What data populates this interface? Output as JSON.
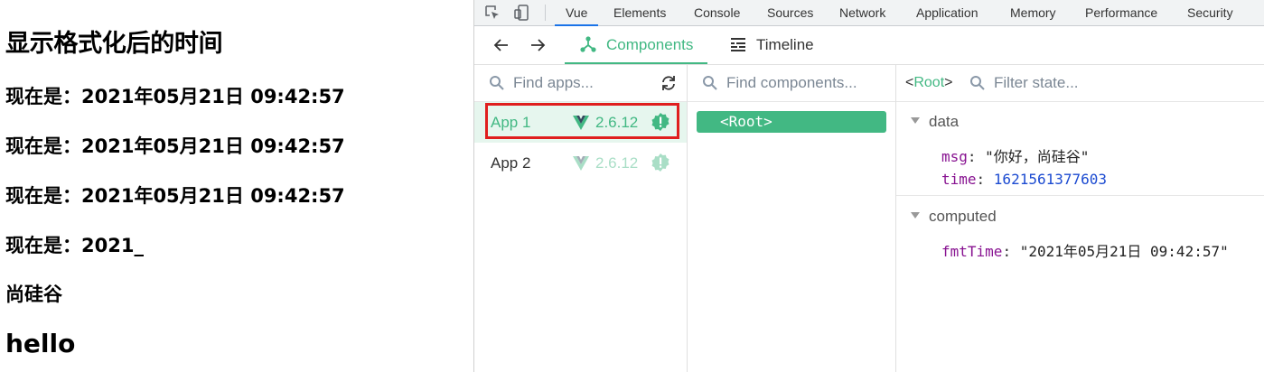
{
  "page": {
    "title": "显示格式化后的时间",
    "lines": [
      "现在是：2021年05月21日 09:42:57",
      "现在是：2021年05月21日 09:42:57",
      "现在是：2021年05月21日 09:42:57",
      "现在是：2021_",
      "尚硅谷"
    ],
    "heading2": "hello"
  },
  "devtools": {
    "tabs": [
      "Vue",
      "Elements",
      "Console",
      "Sources",
      "Network",
      "Application",
      "Memory",
      "Performance",
      "Security"
    ],
    "active_tab": "Vue",
    "vue_tabs": {
      "components": "Components",
      "timeline": "Timeline"
    },
    "apps": {
      "search_placeholder": "Find apps...",
      "items": [
        {
          "name": "App 1",
          "version": "2.6.12",
          "selected": true
        },
        {
          "name": "App 2",
          "version": "2.6.12",
          "selected": false
        }
      ]
    },
    "components": {
      "search_placeholder": "Find components...",
      "root": "<Root>"
    },
    "state": {
      "component": "Root",
      "filter_placeholder": "Filter state...",
      "data_title": "data",
      "data": [
        {
          "key": "msg",
          "value": "\"你好，尚硅谷\""
        },
        {
          "key": "time",
          "value": "1621561377603"
        }
      ],
      "computed_title": "computed",
      "computed": [
        {
          "key": "fmtTime",
          "value": "\"2021年05月21日 09:42:57\""
        }
      ]
    }
  },
  "colors": {
    "vue_green": "#42b883",
    "selected_bg": "#e6f6ee",
    "highlight": "#e01e1e",
    "devtools_blue": "#1a73e8"
  }
}
